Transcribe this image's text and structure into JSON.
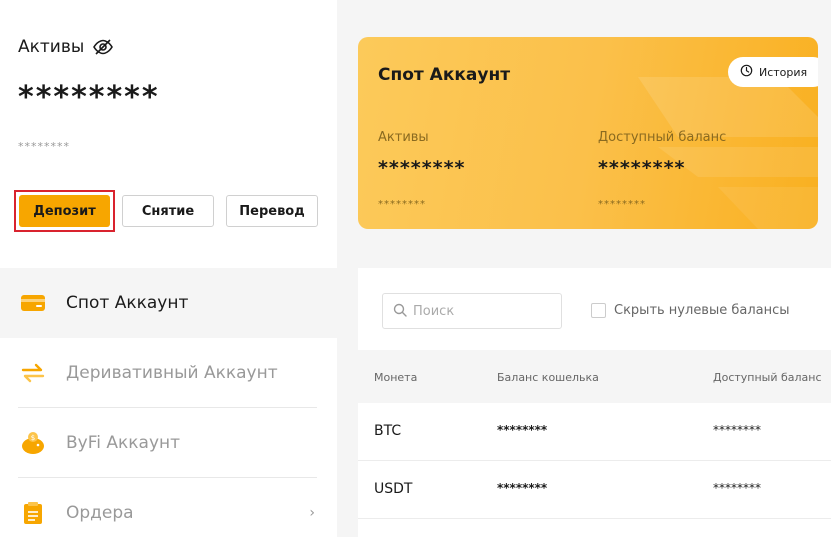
{
  "assets": {
    "title": "Активы",
    "balance_masked": "********",
    "sub_masked": "********"
  },
  "buttons": {
    "deposit": "Депозит",
    "withdraw": "Снятие",
    "transfer": "Перевод"
  },
  "nav": {
    "items": [
      {
        "label": "Спот Аккаунт",
        "icon": "card-icon",
        "active": true
      },
      {
        "label": "Деривативный Аккаунт",
        "icon": "swap-arrows-icon",
        "active": false
      },
      {
        "label": "ByFi Аккаунт",
        "icon": "piggy-bank-icon",
        "active": false
      },
      {
        "label": "Ордера",
        "icon": "clipboard-icon",
        "active": false
      }
    ],
    "chevron": "›"
  },
  "card": {
    "title": "Спот Аккаунт",
    "history_label": "История",
    "assets_label": "Активы",
    "assets_masked": "********",
    "assets_sub": "********",
    "available_label": "Доступный баланс",
    "available_masked": "********",
    "available_sub": "********"
  },
  "search": {
    "placeholder": "Поиск"
  },
  "filter": {
    "hide_zero_label": "Скрыть нулевые балансы"
  },
  "table": {
    "headers": [
      "Монета",
      "Баланс кошелька",
      "Доступный баланс"
    ],
    "rows": [
      {
        "coin": "BTC",
        "wallet": "********",
        "available": "********"
      },
      {
        "coin": "USDT",
        "wallet": "********",
        "available": "********"
      }
    ]
  },
  "colors": {
    "accent": "#f7a600",
    "highlight_border": "#d9232e"
  }
}
